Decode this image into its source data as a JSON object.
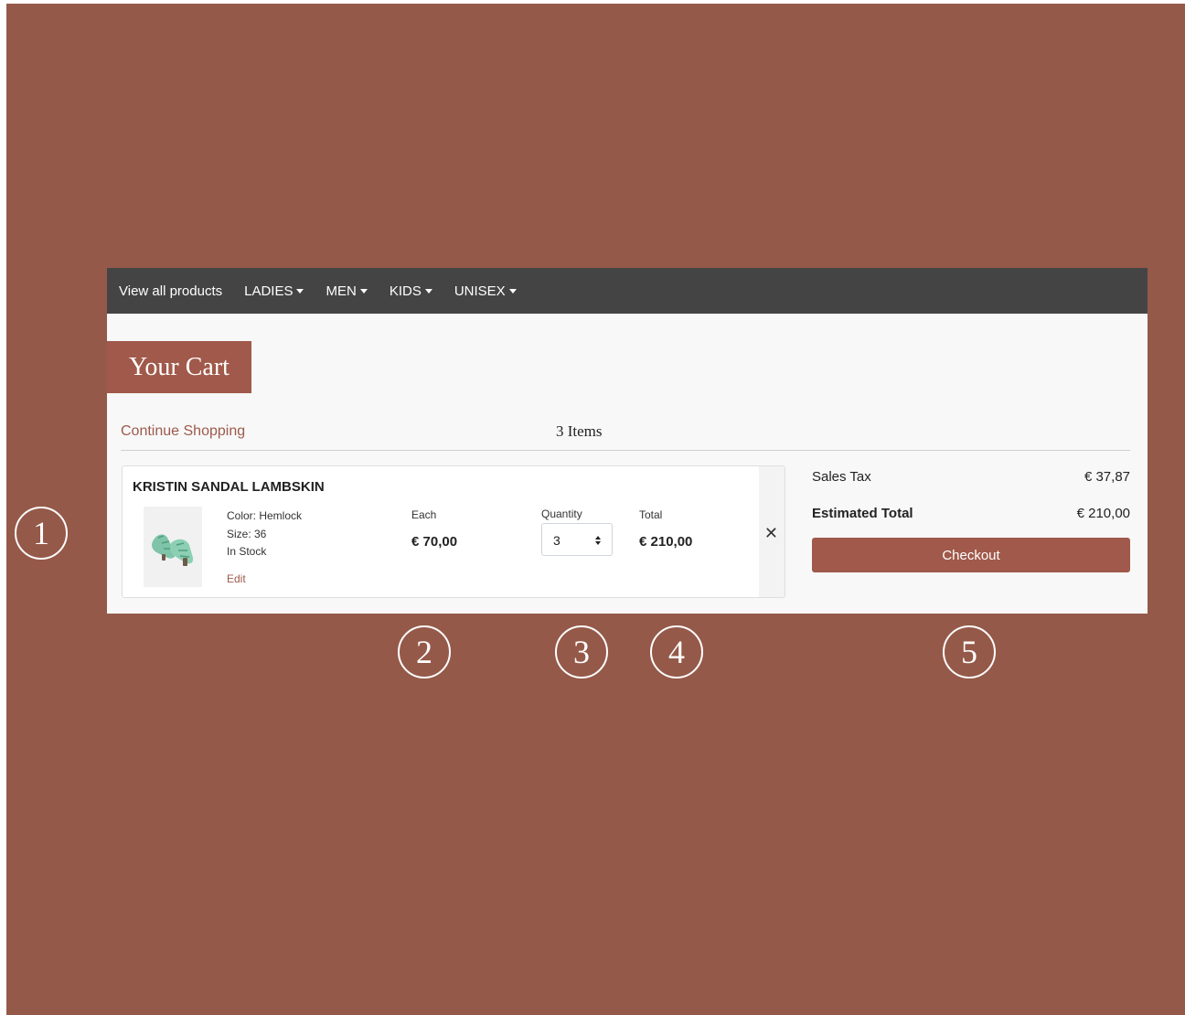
{
  "nav": {
    "items": [
      {
        "label": "View all products",
        "dropdown": false
      },
      {
        "label": "LADIES",
        "dropdown": true
      },
      {
        "label": "MEN",
        "dropdown": true
      },
      {
        "label": "KIDS",
        "dropdown": true
      },
      {
        "label": "UNISEX",
        "dropdown": true
      }
    ]
  },
  "cart": {
    "title": "Your Cart",
    "continue_label": "Continue Shopping",
    "items_count": "3 Items"
  },
  "item": {
    "name": "KRISTIN SANDAL LAMBSKIN",
    "color": "Color: Hemlock",
    "size": "Size: 36",
    "stock": "In Stock",
    "edit_label": "Edit",
    "each_label": "Each",
    "each_price": "€ 70,00",
    "quantity_label": "Quantity",
    "quantity": "3",
    "total_label": "Total",
    "total_price": "€ 210,00",
    "remove_icon": "close-icon"
  },
  "summary": {
    "tax_label": "Sales Tax",
    "tax_value": "€ 37,87",
    "estimated_label": "Estimated Total",
    "estimated_value": "€ 210,00",
    "checkout_label": "Checkout"
  },
  "markers": [
    "1",
    "2",
    "3",
    "4",
    "5"
  ],
  "colors": {
    "background": "#955949",
    "navbar": "#444444",
    "accent": "#a0594a",
    "link": "#9c5a4c"
  }
}
